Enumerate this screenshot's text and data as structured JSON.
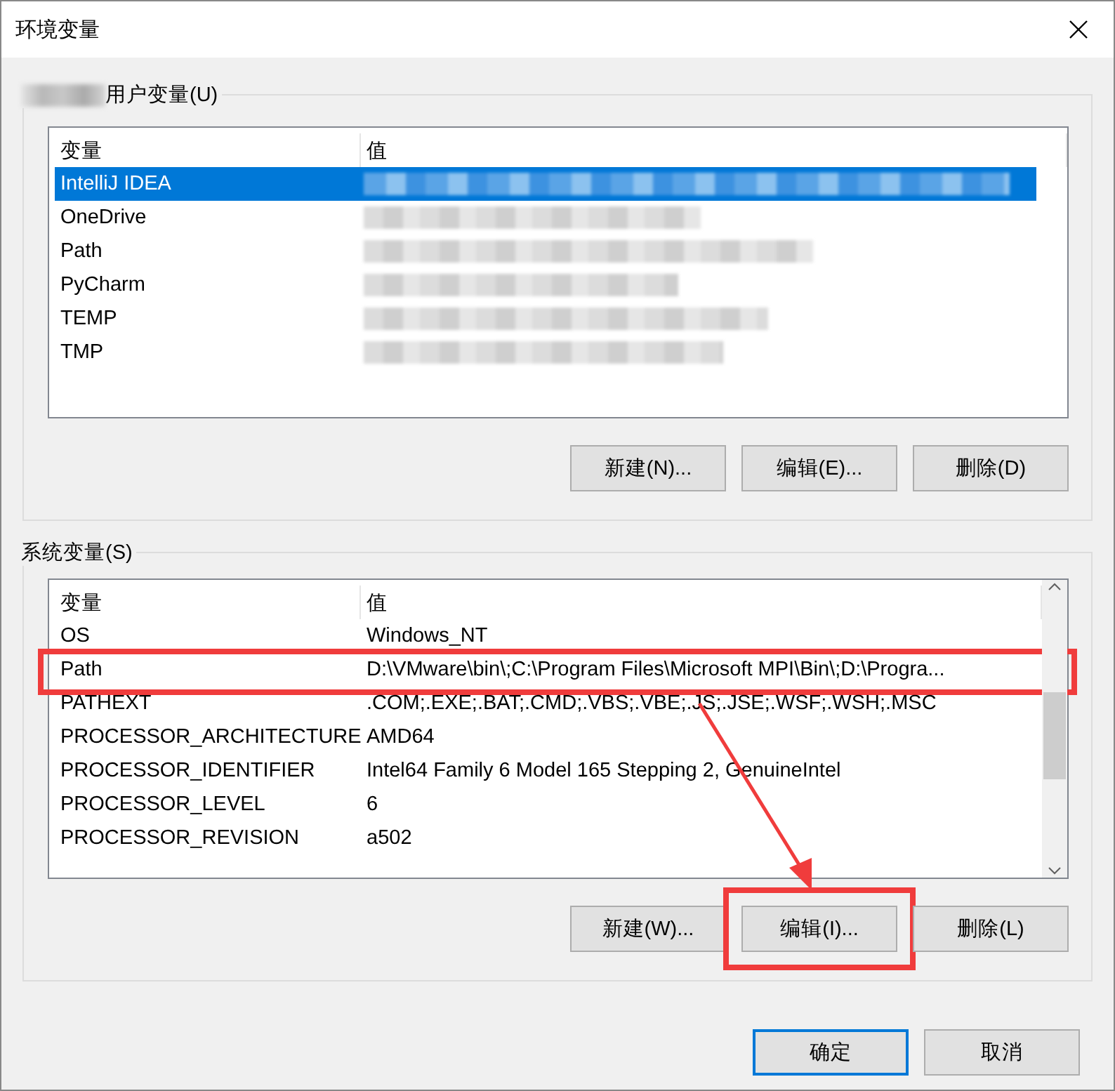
{
  "window": {
    "title": "环境变量"
  },
  "user_group": {
    "label": "用户变量(U)",
    "columns": [
      "变量",
      "值"
    ],
    "rows": [
      {
        "name": "IntelliJ IDEA",
        "selected": true
      },
      {
        "name": "OneDrive",
        "selected": false
      },
      {
        "name": "Path",
        "selected": false
      },
      {
        "name": "PyCharm",
        "selected": false
      },
      {
        "name": "TEMP",
        "selected": false
      },
      {
        "name": "TMP",
        "selected": false
      }
    ],
    "buttons": [
      {
        "label": "新建(N)...",
        "highlighted": false
      },
      {
        "label": "编辑(E)...",
        "highlighted": false
      },
      {
        "label": "删除(D)",
        "highlighted": false
      }
    ]
  },
  "system_group": {
    "label": "系统变量(S)",
    "columns": [
      "变量",
      "值"
    ],
    "rows": [
      {
        "name": "OS",
        "value": "Windows_NT",
        "highlighted": false
      },
      {
        "name": "Path",
        "value": "D:\\VMware\\bin\\;C:\\Program Files\\Microsoft MPI\\Bin\\;D:\\Progra...",
        "highlighted": true
      },
      {
        "name": "PATHEXT",
        "value": ".COM;.EXE;.BAT;.CMD;.VBS;.VBE;.JS;.JSE;.WSF;.WSH;.MSC",
        "highlighted": false
      },
      {
        "name": "PROCESSOR_ARCHITECTURE",
        "value": "AMD64",
        "highlighted": false
      },
      {
        "name": "PROCESSOR_IDENTIFIER",
        "value": "Intel64 Family 6 Model 165 Stepping 2, GenuineIntel",
        "highlighted": false
      },
      {
        "name": "PROCESSOR_LEVEL",
        "value": "6",
        "highlighted": false
      },
      {
        "name": "PROCESSOR_REVISION",
        "value": "a502",
        "highlighted": false
      }
    ],
    "buttons": [
      {
        "label": "新建(W)...",
        "highlighted": false
      },
      {
        "label": "编辑(I)...",
        "highlighted": true
      },
      {
        "label": "删除(L)",
        "highlighted": false
      }
    ]
  },
  "footer_buttons": [
    {
      "label": "确定",
      "default": true
    },
    {
      "label": "取消",
      "default": false
    }
  ]
}
